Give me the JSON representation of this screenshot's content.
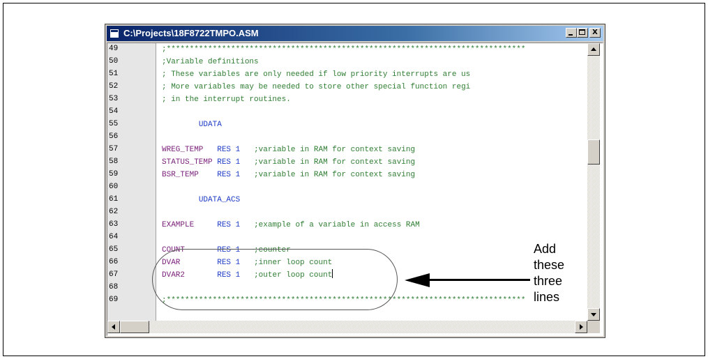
{
  "window": {
    "title": "C:\\Projects\\18F8722TMPO.ASM",
    "buttons": {
      "minimize": "_",
      "maximize": "□",
      "close": "X"
    }
  },
  "editor": {
    "line_numbers": [
      "49",
      "50",
      "51",
      "52",
      "53",
      "54",
      "55",
      "56",
      "57",
      "58",
      "59",
      "60",
      "61",
      "62",
      "63",
      "64",
      "65",
      "66",
      "67",
      "68",
      "69"
    ],
    "lines": [
      {
        "indent": "",
        "parts": [
          {
            "cls": "cmt",
            "text": ";******************************************************************************"
          }
        ]
      },
      {
        "indent": "",
        "parts": [
          {
            "cls": "cmt",
            "text": ";Variable definitions"
          }
        ]
      },
      {
        "indent": "",
        "parts": [
          {
            "cls": "cmt",
            "text": "; These variables are only needed if low priority interrupts are us"
          }
        ]
      },
      {
        "indent": "",
        "parts": [
          {
            "cls": "cmt",
            "text": "; More variables may be needed to store other special function regi"
          }
        ]
      },
      {
        "indent": "",
        "parts": [
          {
            "cls": "cmt",
            "text": "; in the interrupt routines."
          }
        ]
      },
      {
        "indent": "",
        "parts": []
      },
      {
        "indent": "        ",
        "parts": [
          {
            "cls": "dir",
            "text": "UDATA"
          }
        ]
      },
      {
        "indent": "",
        "parts": []
      },
      {
        "indent": "",
        "parts": [
          {
            "cls": "lbl",
            "text": "WREG_TEMP"
          },
          {
            "cls": "",
            "text": "   "
          },
          {
            "cls": "dir",
            "text": "RES 1"
          },
          {
            "cls": "",
            "text": "   "
          },
          {
            "cls": "cmt",
            "text": ";variable in RAM for context saving"
          }
        ]
      },
      {
        "indent": "",
        "parts": [
          {
            "cls": "lbl",
            "text": "STATUS_TEMP"
          },
          {
            "cls": "",
            "text": " "
          },
          {
            "cls": "dir",
            "text": "RES 1"
          },
          {
            "cls": "",
            "text": "   "
          },
          {
            "cls": "cmt",
            "text": ";variable in RAM for context saving"
          }
        ]
      },
      {
        "indent": "",
        "parts": [
          {
            "cls": "lbl",
            "text": "BSR_TEMP"
          },
          {
            "cls": "",
            "text": "    "
          },
          {
            "cls": "dir",
            "text": "RES 1"
          },
          {
            "cls": "",
            "text": "   "
          },
          {
            "cls": "cmt",
            "text": ";variable in RAM for context saving"
          }
        ]
      },
      {
        "indent": "",
        "parts": []
      },
      {
        "indent": "        ",
        "parts": [
          {
            "cls": "dir",
            "text": "UDATA_ACS"
          }
        ]
      },
      {
        "indent": "",
        "parts": []
      },
      {
        "indent": "",
        "parts": [
          {
            "cls": "lbl",
            "text": "EXAMPLE"
          },
          {
            "cls": "",
            "text": "     "
          },
          {
            "cls": "dir",
            "text": "RES 1"
          },
          {
            "cls": "",
            "text": "   "
          },
          {
            "cls": "cmt",
            "text": ";example of a variable in access RAM"
          }
        ]
      },
      {
        "indent": "",
        "parts": []
      },
      {
        "indent": "",
        "parts": [
          {
            "cls": "lbl",
            "text": "COUNT"
          },
          {
            "cls": "",
            "text": "       "
          },
          {
            "cls": "dir",
            "text": "RES 1"
          },
          {
            "cls": "",
            "text": "   "
          },
          {
            "cls": "cmt",
            "text": ";counter"
          }
        ]
      },
      {
        "indent": "",
        "parts": [
          {
            "cls": "lbl",
            "text": "DVAR"
          },
          {
            "cls": "",
            "text": "        "
          },
          {
            "cls": "dir",
            "text": "RES 1"
          },
          {
            "cls": "",
            "text": "   "
          },
          {
            "cls": "cmt",
            "text": ";inner loop count"
          }
        ]
      },
      {
        "indent": "",
        "parts": [
          {
            "cls": "lbl",
            "text": "DVAR2"
          },
          {
            "cls": "",
            "text": "       "
          },
          {
            "cls": "dir",
            "text": "RES 1"
          },
          {
            "cls": "",
            "text": "   "
          },
          {
            "cls": "cmt",
            "text": ";outer loop count"
          },
          {
            "cls": "caret",
            "text": ""
          }
        ]
      },
      {
        "indent": "",
        "parts": []
      },
      {
        "indent": "",
        "parts": [
          {
            "cls": "cmt",
            "text": ";******************************************************************************"
          }
        ]
      }
    ]
  },
  "annotation": {
    "text_lines": [
      "Add",
      "these",
      "three",
      "lines"
    ]
  },
  "colors": {
    "comment": "#2e7d32",
    "directive": "#1f3cc7",
    "label": "#7a1f7a",
    "title_bar": "#0a246a"
  }
}
